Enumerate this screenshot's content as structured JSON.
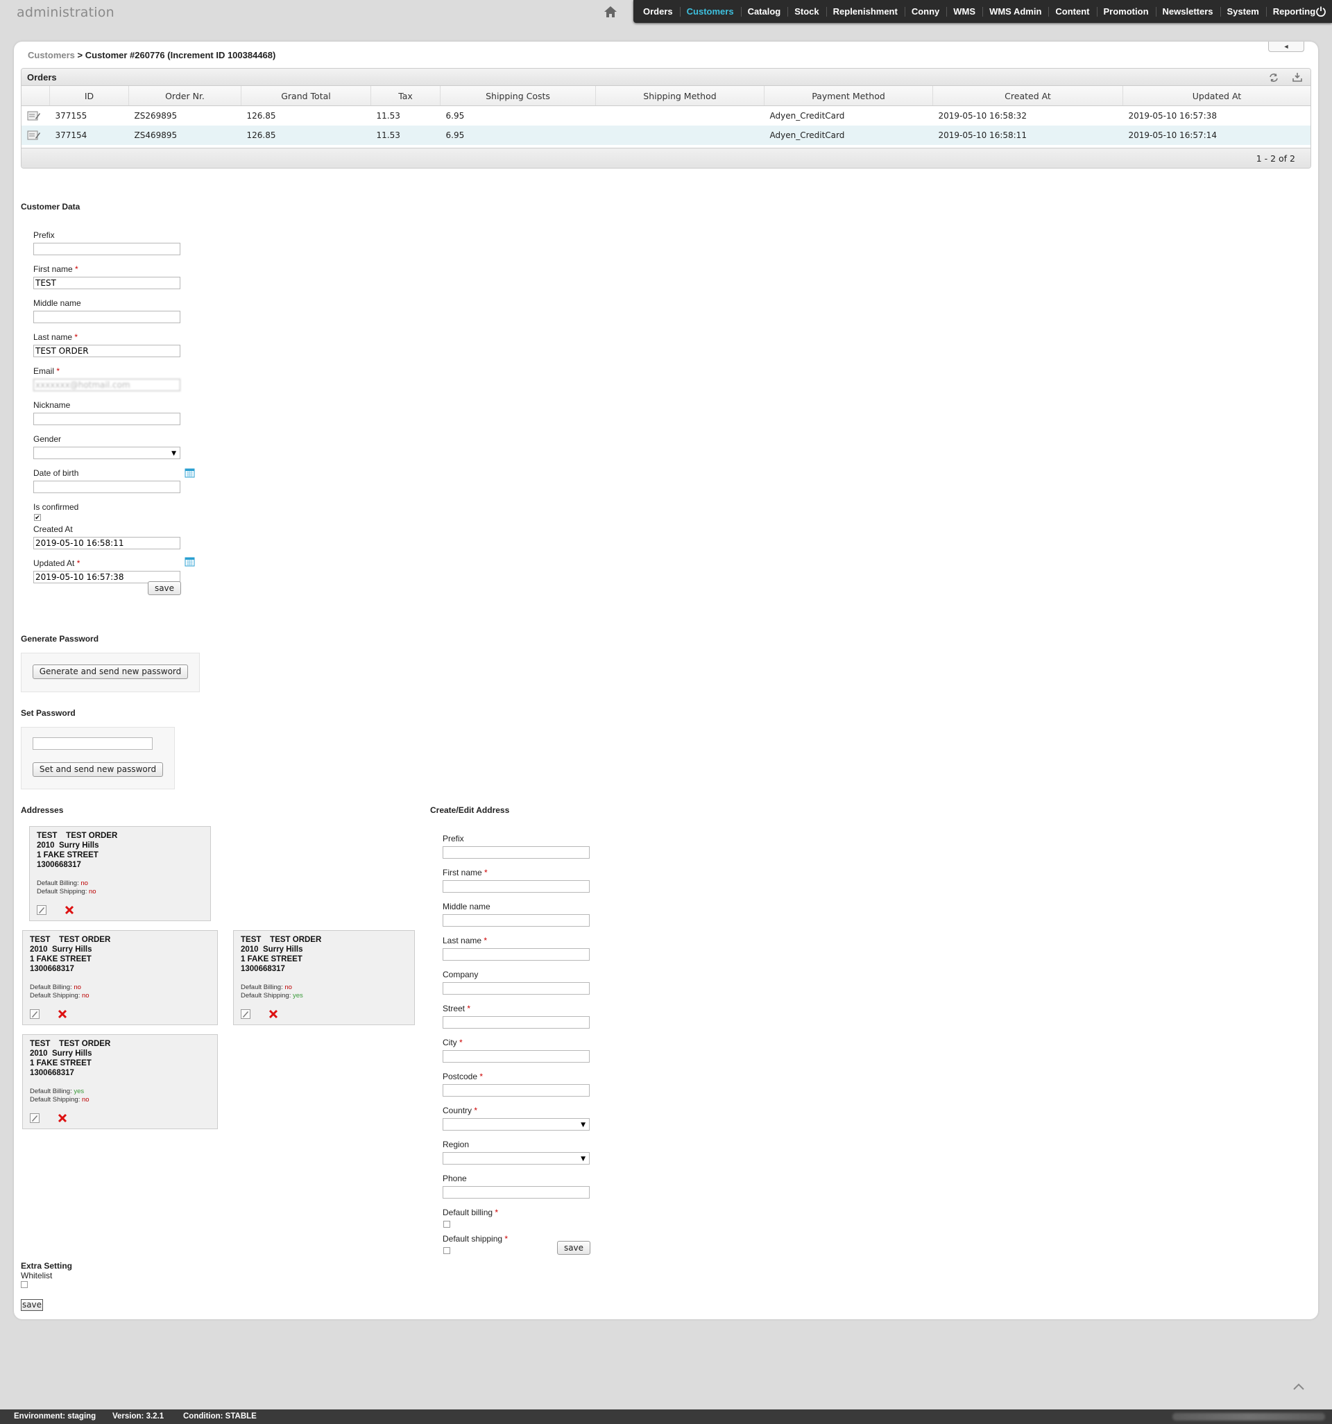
{
  "header": {
    "brand": "administration",
    "nav": [
      "Orders",
      "Customers",
      "Catalog",
      "Stock",
      "Replenishment",
      "Conny",
      "WMS",
      "WMS Admin",
      "Content",
      "Promotion",
      "Newsletters",
      "System",
      "Reporting"
    ],
    "active_nav": "Customers",
    "accent_color": "#3ec0de"
  },
  "breadcrumb": {
    "parent": "Customers",
    "separator": " > ",
    "current": "Customer #260776 (Increment ID 100384468)"
  },
  "orders": {
    "title": "Orders",
    "columns": [
      "ID",
      "Order Nr.",
      "Grand Total",
      "Tax",
      "Shipping Costs",
      "Shipping Method",
      "Payment Method",
      "Created At",
      "Updated At"
    ],
    "rows": [
      {
        "id": "377155",
        "order_nr": "ZS269895",
        "grand_total": "126.85",
        "tax": "11.53",
        "shipping_costs": "6.95",
        "shipping_method": "",
        "payment_method": "Adyen_CreditCard",
        "created_at": "2019-05-10 16:58:32",
        "updated_at": "2019-05-10 16:57:38"
      },
      {
        "id": "377154",
        "order_nr": "ZS469895",
        "grand_total": "126.85",
        "tax": "11.53",
        "shipping_costs": "6.95",
        "shipping_method": "",
        "payment_method": "Adyen_CreditCard",
        "created_at": "2019-05-10 16:58:11",
        "updated_at": "2019-05-10 16:57:14"
      }
    ],
    "pager": "1 - 2 of 2"
  },
  "customer_data": {
    "title": "Customer Data",
    "prefix": {
      "label": "Prefix",
      "value": ""
    },
    "first_name": {
      "label": "First name",
      "value": "TEST"
    },
    "middle_name": {
      "label": "Middle name",
      "value": ""
    },
    "last_name": {
      "label": "Last name",
      "value": "TEST ORDER"
    },
    "email": {
      "label": "Email",
      "value": "xxxxxxx@hotmail.com"
    },
    "nickname": {
      "label": "Nickname",
      "value": ""
    },
    "gender": {
      "label": "Gender",
      "value": ""
    },
    "date_of_birth": {
      "label": "Date of birth",
      "value": ""
    },
    "is_confirmed": {
      "label": "Is confirmed",
      "checked": true
    },
    "created_at": {
      "label": "Created At",
      "value": "2019-05-10 16:58:11"
    },
    "updated_at": {
      "label": "Updated At",
      "value": "2019-05-10 16:57:38"
    },
    "required_mark": "*",
    "save_label": "save"
  },
  "generate_password": {
    "title": "Generate Password",
    "button": "Generate and send new password"
  },
  "set_password": {
    "title": "Set Password",
    "value": "",
    "button": "Set and send new password"
  },
  "addresses": {
    "title": "Addresses",
    "billing_label": "Default Billing:",
    "shipping_label": "Default Shipping:",
    "cards": [
      {
        "name": "TEST    TEST ORDER",
        "city": "2010  Surry Hills",
        "street": "1 FAKE STREET",
        "phone": "1300668317",
        "default_billing": "no",
        "default_shipping": "no"
      },
      {
        "name": "TEST    TEST ORDER",
        "city": "2010  Surry Hills",
        "street": "1 FAKE STREET",
        "phone": "1300668317",
        "default_billing": "no",
        "default_shipping": "no"
      },
      {
        "name": "TEST    TEST ORDER",
        "city": "2010  Surry Hills",
        "street": "1 FAKE STREET",
        "phone": "1300668317",
        "default_billing": "no",
        "default_shipping": "yes"
      },
      {
        "name": "TEST    TEST ORDER",
        "city": "2010  Surry Hills",
        "street": "1 FAKE STREET",
        "phone": "1300668317",
        "default_billing": "yes",
        "default_shipping": "no"
      }
    ]
  },
  "address_form": {
    "title": "Create/Edit Address",
    "prefix": "Prefix",
    "first_name": "First name",
    "middle_name": "Middle name",
    "last_name": "Last name",
    "company": "Company",
    "street": "Street",
    "city": "City",
    "postcode": "Postcode",
    "country": "Country",
    "region": "Region",
    "phone": "Phone",
    "default_billing": "Default billing",
    "default_shipping": "Default shipping",
    "save_label": "save"
  },
  "extra_setting": {
    "title": "Extra Setting",
    "whitelist_label": "Whitelist",
    "whitelist_checked": false,
    "save_label": "save"
  },
  "status_bar": {
    "environment": "Environment: staging",
    "version": "Version: 3.2.1",
    "condition": "Condition: STABLE"
  },
  "icons": [
    "home-icon",
    "power-icon",
    "refresh-icon",
    "download-icon",
    "edit-order-icon",
    "calendar-icon",
    "edit-address-icon",
    "delete-address-icon",
    "scroll-top-icon"
  ]
}
